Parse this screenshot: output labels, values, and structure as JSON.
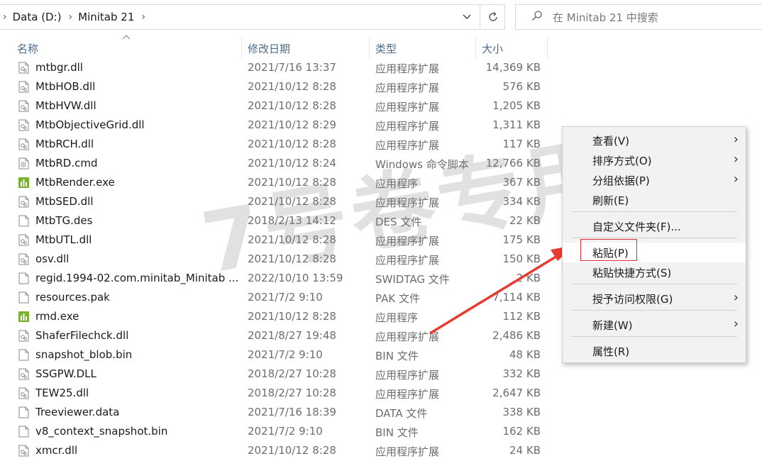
{
  "address": {
    "crumbs": [
      "Data (D:)",
      "Minitab 21"
    ],
    "search_placeholder": "在 Minitab 21 中搜索"
  },
  "columns": {
    "name": "名称",
    "date": "修改日期",
    "type": "类型",
    "size": "大小"
  },
  "files": [
    {
      "icon": "dll-file-icon",
      "name": "mtbgr.dll",
      "date": "2021/7/16 13:37",
      "type": "应用程序扩展",
      "size": "14,369 KB"
    },
    {
      "icon": "dll-file-icon",
      "name": "MtbHOB.dll",
      "date": "2021/10/12 8:28",
      "type": "应用程序扩展",
      "size": "576 KB"
    },
    {
      "icon": "dll-file-icon",
      "name": "MtbHVW.dll",
      "date": "2021/10/12 8:28",
      "type": "应用程序扩展",
      "size": "1,205 KB"
    },
    {
      "icon": "dll-file-icon",
      "name": "MtbObjectiveGrid.dll",
      "date": "2021/10/12 8:29",
      "type": "应用程序扩展",
      "size": "1,311 KB"
    },
    {
      "icon": "dll-file-icon",
      "name": "MtbRCH.dll",
      "date": "2021/10/12 8:28",
      "type": "应用程序扩展",
      "size": "117 KB"
    },
    {
      "icon": "cmd-file-icon",
      "name": "MtbRD.cmd",
      "date": "2021/10/12 8:24",
      "type": "Windows 命令脚本",
      "size": "12,766 KB"
    },
    {
      "icon": "exe-file-icon",
      "name": "MtbRender.exe",
      "date": "2021/10/12 8:28",
      "type": "应用程序",
      "size": "367 KB"
    },
    {
      "icon": "dll-file-icon",
      "name": "MtbSED.dll",
      "date": "2021/10/12 8:28",
      "type": "应用程序扩展",
      "size": "334 KB"
    },
    {
      "icon": "blank-file-icon",
      "name": "MtbTG.des",
      "date": "2018/2/13 14:12",
      "type": "DES 文件",
      "size": "22 KB"
    },
    {
      "icon": "dll-file-icon",
      "name": "MtbUTL.dll",
      "date": "2021/10/12 8:28",
      "type": "应用程序扩展",
      "size": "175 KB"
    },
    {
      "icon": "dll-file-icon",
      "name": "osv.dll",
      "date": "2021/10/12 8:28",
      "type": "应用程序扩展",
      "size": "150 KB"
    },
    {
      "icon": "blank-file-icon",
      "name": "regid.1994-02.com.minitab_Minitab ...",
      "date": "2022/10/10 13:59",
      "type": "SWIDTAG 文件",
      "size": "2 KB"
    },
    {
      "icon": "blank-file-icon",
      "name": "resources.pak",
      "date": "2021/7/2 9:10",
      "type": "PAK 文件",
      "size": "7,114 KB"
    },
    {
      "icon": "exe-file-icon",
      "name": "rmd.exe",
      "date": "2021/10/12 8:28",
      "type": "应用程序",
      "size": "112 KB"
    },
    {
      "icon": "dll-file-icon",
      "name": "ShaferFilechck.dll",
      "date": "2021/8/27 19:48",
      "type": "应用程序扩展",
      "size": "2,486 KB"
    },
    {
      "icon": "blank-file-icon",
      "name": "snapshot_blob.bin",
      "date": "2021/7/2 9:10",
      "type": "BIN 文件",
      "size": "48 KB"
    },
    {
      "icon": "dll-file-icon",
      "name": "SSGPW.DLL",
      "date": "2018/2/27 10:28",
      "type": "应用程序扩展",
      "size": "332 KB"
    },
    {
      "icon": "dll-file-icon",
      "name": "TEW25.dll",
      "date": "2018/2/27 10:28",
      "type": "应用程序扩展",
      "size": "2,647 KB"
    },
    {
      "icon": "blank-file-icon",
      "name": "Treeviewer.data",
      "date": "2021/7/16 18:39",
      "type": "DATA 文件",
      "size": "338 KB"
    },
    {
      "icon": "blank-file-icon",
      "name": "v8_context_snapshot.bin",
      "date": "2021/7/2 9:10",
      "type": "BIN 文件",
      "size": "162 KB"
    },
    {
      "icon": "dll-file-icon",
      "name": "xmcr.dll",
      "date": "2021/10/12 8:28",
      "type": "应用程序扩展",
      "size": "24 KB"
    }
  ],
  "watermark": "7号卷专用",
  "context_menu": {
    "view": "查看(V)",
    "sort": "排序方式(O)",
    "group": "分组依据(P)",
    "refresh": "刷新(E)",
    "customize": "自定义文件夹(F)...",
    "paste": "粘贴(P)",
    "paste_shortcut": "粘贴快捷方式(S)",
    "access": "授予访问权限(G)",
    "new": "新建(W)",
    "properties": "属性(R)"
  },
  "colors": {
    "highlight": "#e03030",
    "header_text": "#4d6a89",
    "exe_green": "#7bb32e"
  }
}
